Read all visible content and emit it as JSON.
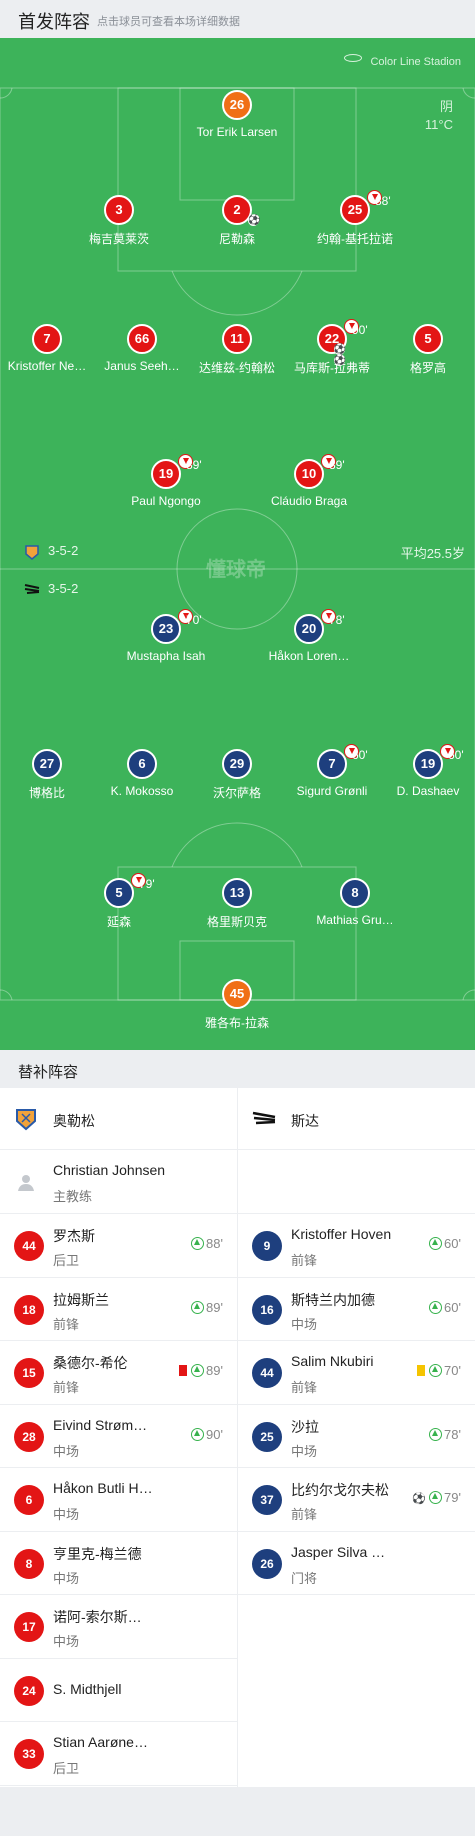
{
  "header": {
    "title": "首发阵容",
    "subtitle": "点击球员可查看本场详细数据"
  },
  "pitch": {
    "stadium": "Color Line Stadion",
    "weather": "阴",
    "temperature": "11°C",
    "watermark": "懂球帝",
    "home_formation": "3-5-2",
    "away_formation": "3-5-2",
    "avg_age": "平均25.5岁"
  },
  "home_players": [
    {
      "num": "26",
      "name": "Tor Erik Larsen",
      "color": "org"
    },
    {
      "num": "3",
      "name": "梅吉莫莱茨",
      "color": "red"
    },
    {
      "num": "2",
      "name": "尼勒森",
      "color": "red",
      "goals": 1
    },
    {
      "num": "25",
      "name": "约翰-基托拉诺",
      "color": "red",
      "sub": "88'"
    },
    {
      "num": "7",
      "name": "Kristoffer Ne…",
      "color": "red"
    },
    {
      "num": "66",
      "name": "Janus Seeh…",
      "color": "red"
    },
    {
      "num": "11",
      "name": "达维兹-约翰松",
      "color": "red"
    },
    {
      "num": "22",
      "name": "马库斯-拉弗蒂",
      "color": "red",
      "sub": "90'",
      "goals": 2
    },
    {
      "num": "5",
      "name": "格罗高",
      "color": "red"
    },
    {
      "num": "19",
      "name": "Paul Ngongo",
      "color": "red",
      "sub": "89'"
    },
    {
      "num": "10",
      "name": "Cláudio Braga",
      "color": "red",
      "sub": "89'"
    }
  ],
  "away_players": [
    {
      "num": "23",
      "name": "Mustapha Isah",
      "color": "blue",
      "sub": "70'"
    },
    {
      "num": "20",
      "name": "Håkon Loren…",
      "color": "blue",
      "sub": "78'"
    },
    {
      "num": "27",
      "name": "博格比",
      "color": "blue"
    },
    {
      "num": "6",
      "name": "K. Mokosso",
      "color": "blue"
    },
    {
      "num": "29",
      "name": "沃尔萨格",
      "color": "blue"
    },
    {
      "num": "7",
      "name": "Sigurd Grønli",
      "color": "blue",
      "sub": "60'"
    },
    {
      "num": "19",
      "name": "D. Dashaev",
      "color": "blue",
      "sub": "60'"
    },
    {
      "num": "5",
      "name": "延森",
      "color": "blue",
      "sub": "79'"
    },
    {
      "num": "13",
      "name": "格里斯贝克",
      "color": "blue"
    },
    {
      "num": "8",
      "name": "Mathias Gru…",
      "color": "blue"
    },
    {
      "num": "45",
      "name": "雅各布-拉森",
      "color": "org"
    }
  ],
  "bench": {
    "title": "替补阵容",
    "home": {
      "team": "奥勒松",
      "coach": {
        "name": "Christian Johnsen",
        "role": "主教练"
      },
      "subs": [
        {
          "num": "44",
          "name": "罗杰斯",
          "pos": "后卫",
          "time": "88'"
        },
        {
          "num": "18",
          "name": "拉姆斯兰",
          "pos": "前锋",
          "time": "89'"
        },
        {
          "num": "15",
          "name": "桑德尔-希伦",
          "pos": "前锋",
          "time": "89'",
          "card": "red"
        },
        {
          "num": "28",
          "name": "Eivind Strøm…",
          "pos": "中场",
          "time": "90'"
        },
        {
          "num": "6",
          "name": "Håkon Butli H…",
          "pos": "中场"
        },
        {
          "num": "8",
          "name": "亨里克-梅兰德",
          "pos": "中场"
        },
        {
          "num": "17",
          "name": "诺阿-索尔斯…",
          "pos": "中场"
        },
        {
          "num": "24",
          "name": "S. Midthjell",
          "pos": ""
        },
        {
          "num": "33",
          "name": "Stian Aarøne…",
          "pos": "后卫"
        }
      ]
    },
    "away": {
      "team": "斯达",
      "subs": [
        {
          "num": "9",
          "name": "Kristoffer Hoven",
          "pos": "前锋",
          "time": "60'"
        },
        {
          "num": "16",
          "name": "斯特兰内加德",
          "pos": "中场",
          "time": "60'"
        },
        {
          "num": "44",
          "name": "Salim Nkubiri",
          "pos": "前锋",
          "time": "70'",
          "card": "yellow"
        },
        {
          "num": "25",
          "name": "沙拉",
          "pos": "中场",
          "time": "78'"
        },
        {
          "num": "37",
          "name": "比约尔戈尔夫松",
          "pos": "前锋",
          "time": "79'",
          "goal": true
        },
        {
          "num": "26",
          "name": "Jasper Silva …",
          "pos": "门将"
        }
      ]
    }
  },
  "colors": {
    "pitch": "#3db35a",
    "home": "#e31515",
    "away": "#1e3f7e",
    "gk": "#f06f16",
    "sub_in": "#37b24d"
  }
}
